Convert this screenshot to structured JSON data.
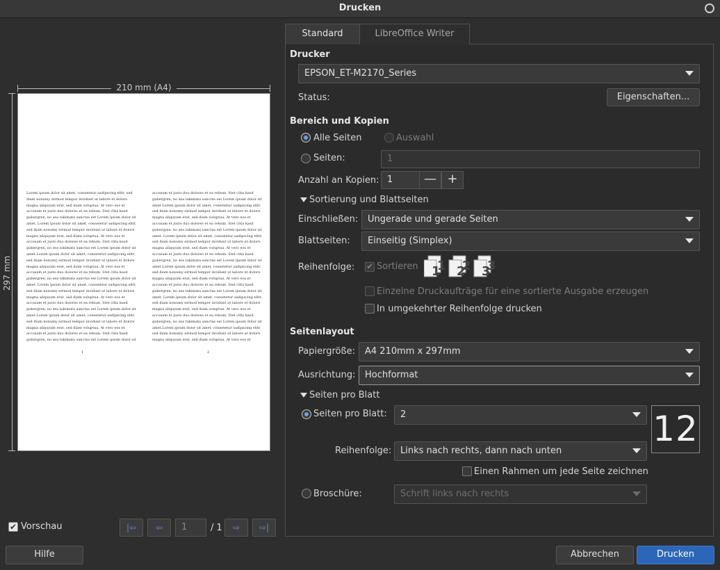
{
  "window": {
    "title": "Drucken"
  },
  "preview": {
    "width_label": "210 mm (A4)",
    "height_label": "297 mm",
    "left_text": "Lorem ipsum dolor sit amet, consetetur sadipscing elitr, sed diam nonumy eirmod tempor invidunt ut labore et dolore magna aliquyam erat, sed diam voluptua. At vero eos et accusam et justo duo dolores et ea rebum. Stet clita kasd gubergren, no sea takimata sanctus est Lorem ipsum dolor sit amet. Lorem ipsum dolor sit amet, consetetur sadipscing elitr, sed diam nonumy eirmod tempor invidunt ut labore et dolore magna aliquyam erat, sed diam voluptua. At vero eos et accusam et justo duo dolores et ea rebum. Stet clita kasd gubergren, no sea takimata sanctus est Lorem ipsum dolor sit amet.Lorem ipsum dolor sit amet, consetetur sadipscing elitr, sed diam nonumy eirmod tempor invidunt ut labore et dolore magna aliquyam erat, sed diam voluptua. At vero eos et accusam et justo duo dolores et ea rebum. Stet clita kasd gubergren, no sea takimata sanctus est Lorem ipsum dolor sit amet. Lorem ipsum dolor sit amet, consetetur sadipscing elitr, sed diam nonumy eirmod tempor invidunt ut labore et dolore magna aliquyam erat, sed diam voluptua. At vero eos et accusam et justo duo dolores et ea rebum. Stet clita kasd gubergren, no sea takimata sanctus est Lorem ipsum dolor sit amet.Lorem ipsum dolor sit amet, consetetur sadipscing elitr, sed diam nonumy eirmod tempor invidunt ut labore et dolore magna aliquyam erat, sed diam voluptua. At vero eos et accusam et justo duo dolores et ea rebum. Stet clita kasd gubergren, no sea takimata sanctus est Lorem ipsum dolor sit amet. Lorem ipsum dolor sit amet, consetetur sadipscing elitr, sed diam nonumy eirmod tempor invidunt ut labore et dolore magna aliquyam erat, sed diam voluptua. At vero eos et",
    "right_text": "accusam et justo duo dolores et ea rebum. Stet clita kasd gubergren, no sea takimata sanctus est Lorem ipsum dolor sit amet.Lorem ipsum dolor sit amet, consetetur sadipscing elitr, sed diam nonumy eirmod tempor invidunt ut labore et dolore magna aliquyam erat, sed diam voluptua. At vero eos et accusam et justo duo dolores et ea rebum. Stet clita kasd gubergren, no sea takimata sanctus est Lorem ipsum dolor sit amet. Lorem ipsum dolor sit amet, consetetur sadipscing elitr, sed diam nonumy eirmod tempor invidunt ut labore et dolore magna aliquyam erat, sed diam voluptua. At vero eos et accusam et justo duo dolores et ea rebum. Stet clita kasd gubergren, no sea takimata sanctus est Lorem ipsum dolor sit amet.Lorem ipsum dolor sit amet, consetetur sadipscing elitr, sed diam nonumy eirmod tempor invidunt ut labore et dolore magna aliquyam erat, sed diam voluptua. At vero eos et accusam et justo duo dolores et ea rebum. Stet clita kasd gubergren, no sea takimata sanctus est Lorem ipsum dolor sit amet. Lorem ipsum dolor sit amet, consetetur sadipscing elitr, sed diam nonumy eirmod tempor invidunt ut labore et dolore magna aliquyam erat, sed diam voluptua. At vero eos et accusam et justo duo dolores et ea rebum. Stet clita kasd gubergren, no sea takimata sanctus est Lorem ipsum dolor sit amet.Lorem ipsum dolor sit amet, consetetur sadipscing elitr, sed diam nonumy eirmod tempor invidunt ut labore et dolore magna aliquyam erat, sed diam voluptua. At vero eos et",
    "left_page_number": "1",
    "right_page_number": "2",
    "show_preview_label": "Vorschau",
    "current_page": "1",
    "total_pages": "/ 1"
  },
  "tabs": [
    {
      "label": "Standard",
      "active": true
    },
    {
      "label": "LibreOffice Writer",
      "active": false
    }
  ],
  "printer": {
    "section_title": "Drucker",
    "selected": "EPSON_ET-M2170_Series",
    "status_label": "Status:",
    "properties_button": "Eigenschaften..."
  },
  "range": {
    "section_title": "Bereich und Kopien",
    "all_pages_label": "Alle Seiten",
    "selection_label": "Auswahl",
    "pages_label": "Seiten:",
    "pages_value": "1",
    "copies_label": "Anzahl an Kopien:",
    "copies_value": "1",
    "minus_symbol": "—",
    "plus_symbol": "+",
    "collation_expander": "Sortierung und Blattseiten",
    "include_label": "Einschließen:",
    "include_value": "Ungerade und gerade Seiten",
    "sides_label": "Blattseiten:",
    "sides_value": "Einseitig (Simplex)",
    "order_label": "Reihenfolge:",
    "collate_label": "Sortieren",
    "separate_jobs_label": "Einzelne Druckaufträge für eine sortierte Ausgabe erzeugen",
    "reverse_label": "In umgekehrter Reihenfolge drucken"
  },
  "layout": {
    "section_title": "Seitenlayout",
    "paper_size_label": "Papiergröße:",
    "paper_size_value": "A4 210mm x 297mm",
    "orientation_label": "Ausrichtung:",
    "orientation_value": "Hochformat",
    "pages_per_sheet_expander": "Seiten pro Blatt",
    "pages_per_sheet_label": "Seiten pro Blatt:",
    "pages_per_sheet_value": "2",
    "order_label": "Reihenfolge:",
    "order_value": "Links nach rechts, dann nach unten",
    "border_label": "Einen Rahmen um jede Seite zeichnen",
    "brochure_label": "Broschüre:",
    "brochure_value": "Schrift links nach rechts",
    "nup_preview": "12"
  },
  "buttons": {
    "help": "Hilfe",
    "cancel": "Abbrechen",
    "print": "Drucken"
  },
  "colors": {
    "accent": "#2c66b8",
    "radio_dot": "#6f9be8"
  }
}
